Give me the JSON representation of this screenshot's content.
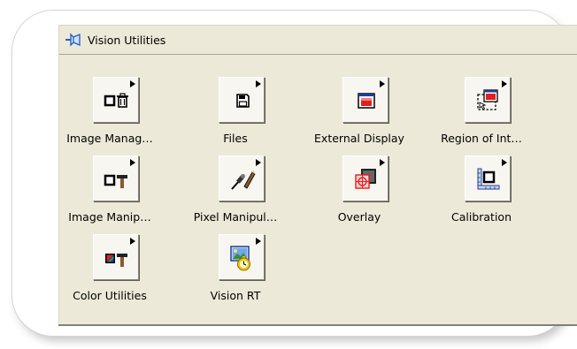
{
  "palette": {
    "title": "Vision Utilities",
    "items": [
      {
        "label": "Image Manag…",
        "icon": "image-management-icon"
      },
      {
        "label": "Files",
        "icon": "floppy-disk-icon"
      },
      {
        "label": "External Display",
        "icon": "external-display-icon"
      },
      {
        "label": "Region of Int…",
        "icon": "region-of-interest-icon"
      },
      {
        "label": "Image Manip…",
        "icon": "image-manipulation-icon"
      },
      {
        "label": "Pixel Manipul…",
        "icon": "pixel-manipulation-icon"
      },
      {
        "label": "Overlay",
        "icon": "overlay-icon"
      },
      {
        "label": "Calibration",
        "icon": "calibration-icon"
      },
      {
        "label": "Color Utilities",
        "icon": "color-utilities-icon"
      },
      {
        "label": "Vision RT",
        "icon": "vision-rt-icon"
      }
    ]
  },
  "colors": {
    "palette_bg": "#ece9d8",
    "accent_red": "#e02020",
    "accent_blue": "#1f3d99"
  }
}
